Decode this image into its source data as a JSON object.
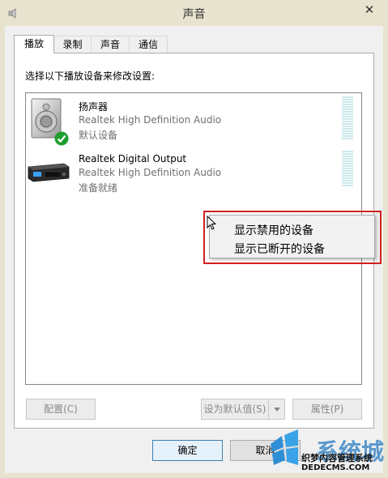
{
  "window": {
    "title": "声音",
    "close_glyph": "✕"
  },
  "tabs": [
    {
      "label": "播放",
      "active": true
    },
    {
      "label": "录制",
      "active": false
    },
    {
      "label": "声音",
      "active": false
    },
    {
      "label": "通信",
      "active": false
    }
  ],
  "playback": {
    "instruction": "选择以下播放设备来修改设置:",
    "devices": [
      {
        "name": "扬声器",
        "driver": "Realtek High Definition Audio",
        "status": "默认设备",
        "icon": "speaker-icon",
        "is_default": true
      },
      {
        "name": "Realtek Digital Output",
        "driver": "Realtek High Definition Audio",
        "status": "准备就绪",
        "icon": "digital-output-icon",
        "is_default": false
      }
    ]
  },
  "context_menu": {
    "items": [
      "显示禁用的设备",
      "显示已断开的设备"
    ],
    "highlight_color": "#d02020"
  },
  "buttons": {
    "configure": "配置(C)",
    "set_default": "设为默认值(S)",
    "properties": "属性(P)",
    "ok": "确定",
    "cancel": "取消"
  },
  "watermark": {
    "brand": "系统城",
    "name": "织梦内容管理系统",
    "url": "DEDECMS.COM"
  },
  "colors": {
    "accent_check": "#1e9e2e",
    "level_meter": "#cde8ea",
    "highlight": "#d02020"
  }
}
